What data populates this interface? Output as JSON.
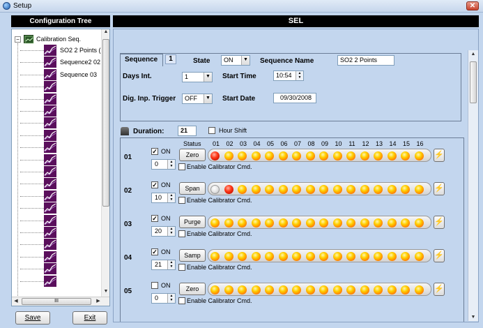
{
  "window": {
    "title": "Setup",
    "close_glyph": "✕",
    "icon": "setup-app-icon"
  },
  "tree": {
    "header": "Configuration Tree",
    "root_label": "Calibration Seq.",
    "collapse_glyph": "−",
    "items": [
      {
        "label": "SO2 2 Points ("
      },
      {
        "label": "Sequence2 02"
      },
      {
        "label": "Sequence 03"
      }
    ],
    "empty_nodes": 17,
    "scroll_hthumb": "III"
  },
  "buttons": {
    "save": "Save",
    "exit": "Exit"
  },
  "panel": {
    "header": "SEL",
    "sequence": {
      "label": "Sequence",
      "number": "1",
      "state_label": "State",
      "state_value": "ON",
      "name_label": "Sequence Name",
      "name_value": "SO2 2 Points",
      "days_int_label": "Days Int.",
      "days_int_value": "1",
      "start_time_label": "Start Time",
      "start_time_value": "10:54",
      "dig_inp_label": "Dig. Inp. Trigger",
      "dig_inp_value": "OFF",
      "start_date_label": "Start Date",
      "start_date_value": "09/30/2008"
    },
    "duration": {
      "label": "Duration:",
      "value": "21",
      "hour_shift_label": "Hour Shift",
      "hour_shift_checked": false
    },
    "status_header": "Status",
    "columns": [
      "01",
      "02",
      "03",
      "04",
      "05",
      "06",
      "07",
      "08",
      "09",
      "10",
      "11",
      "12",
      "13",
      "14",
      "15",
      "16"
    ],
    "enable_label": "Enable Calibrator Cmd.",
    "on_label": "ON",
    "check_glyph": "✓",
    "bolt_icon": "lightning-bolt-icon",
    "rows": [
      {
        "num": "01",
        "on": true,
        "duration": "0",
        "status": "Zero",
        "leds": [
          "red",
          "yellow",
          "yellow",
          "yellow",
          "yellow",
          "yellow",
          "yellow",
          "yellow",
          "yellow",
          "yellow",
          "yellow",
          "yellow",
          "yellow",
          "yellow",
          "yellow",
          "yellow"
        ]
      },
      {
        "num": "02",
        "on": true,
        "duration": "10",
        "status": "Span",
        "leds": [
          "off",
          "red",
          "yellow",
          "yellow",
          "yellow",
          "yellow",
          "yellow",
          "yellow",
          "yellow",
          "yellow",
          "yellow",
          "yellow",
          "yellow",
          "yellow",
          "yellow",
          "yellow"
        ]
      },
      {
        "num": "03",
        "on": true,
        "duration": "20",
        "status": "Purge",
        "leds": [
          "yellow",
          "yellow",
          "yellow",
          "yellow",
          "yellow",
          "yellow",
          "yellow",
          "yellow",
          "yellow",
          "yellow",
          "yellow",
          "yellow",
          "yellow",
          "yellow",
          "yellow",
          "yellow"
        ]
      },
      {
        "num": "04",
        "on": true,
        "duration": "21",
        "status": "Samp",
        "leds": [
          "yellow",
          "yellow",
          "yellow",
          "yellow",
          "yellow",
          "yellow",
          "yellow",
          "yellow",
          "yellow",
          "yellow",
          "yellow",
          "yellow",
          "yellow",
          "yellow",
          "yellow",
          "yellow"
        ]
      },
      {
        "num": "05",
        "on": false,
        "duration": "0",
        "status": "Zero",
        "leds": [
          "yellow",
          "yellow",
          "yellow",
          "yellow",
          "yellow",
          "yellow",
          "yellow",
          "yellow",
          "yellow",
          "yellow",
          "yellow",
          "yellow",
          "yellow",
          "yellow",
          "yellow",
          "yellow"
        ]
      }
    ]
  },
  "colors": {
    "background": "#c3d6ee",
    "header_bg": "#000000",
    "tree_icon": "#5a0f5c",
    "led_yellow": "#ffb300",
    "led_red": "#e01a00"
  }
}
